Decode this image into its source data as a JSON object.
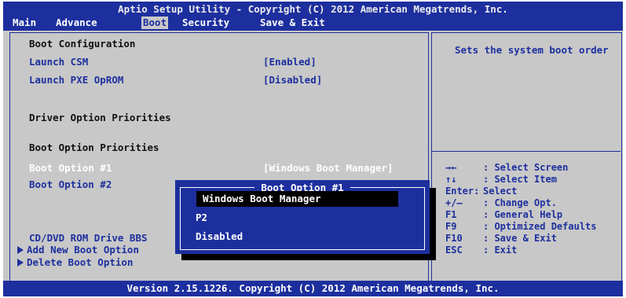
{
  "header": {
    "title": "Aptio Setup Utility - Copyright (C) 2012 American Megatrends, Inc.",
    "tabs": [
      {
        "label": "Main",
        "active": false
      },
      {
        "label": "Advance",
        "active": false
      },
      {
        "label": "Boot",
        "active": true
      },
      {
        "label": "Security",
        "active": false
      },
      {
        "label": "Save & Exit",
        "active": false
      }
    ]
  },
  "settings": {
    "section_boot_config": "Boot Configuration",
    "launch_csm": {
      "label": "Launch CSM",
      "value": "[Enabled]"
    },
    "launch_pxe": {
      "label": "Launch PXE OpROM",
      "value": "[Disabled]"
    },
    "section_driver_priorities": "Driver Option Priorities",
    "section_boot_priorities": "Boot Option Priorities",
    "boot_option_1": {
      "label": "Boot Option #1",
      "value": "[Windows Boot Manager]"
    },
    "boot_option_2": {
      "label": "Boot Option #2"
    },
    "cd_dvd_bbs": "CD/DVD ROM Drive BBS",
    "add_boot_option": "Add New Boot Option",
    "delete_boot_option": "Delete Boot Option"
  },
  "help": {
    "description": "Sets the system boot order",
    "keys": [
      {
        "key": "→←",
        "action": ": Select Screen"
      },
      {
        "key": "↑↓",
        "action": ": Select Item"
      },
      {
        "key": "Enter:",
        "action": "Select"
      },
      {
        "key": "+/—",
        "action": ": Change Opt."
      },
      {
        "key": "F1",
        "action": ": General Help"
      },
      {
        "key": "F9",
        "action": ": Optimized Defaults"
      },
      {
        "key": "F10",
        "action": ": Save & Exit"
      },
      {
        "key": "ESC",
        "action": ": Exit"
      }
    ]
  },
  "popup": {
    "title": "Boot Option #1",
    "options": [
      "Windows Boot Manager",
      "P2",
      "Disabled"
    ],
    "selected": "Windows Boot Manager"
  },
  "footer": {
    "version": "Version 2.15.1226. Copyright (C) 2012 American Megatrends, Inc."
  },
  "colors": {
    "bios_blue": "#1d2f9e",
    "bios_gray": "#c8c8c8",
    "highlight_white": "#ffffff"
  }
}
